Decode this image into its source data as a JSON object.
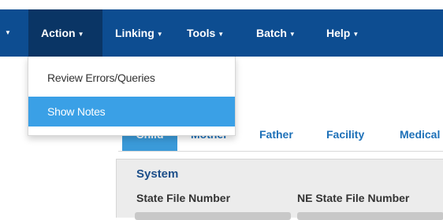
{
  "nav": {
    "items": [
      {
        "label": "Action",
        "active": true
      },
      {
        "label": "Linking"
      },
      {
        "label": "Tools"
      },
      {
        "label": "Batch"
      },
      {
        "label": "Help"
      }
    ]
  },
  "action_menu": {
    "items": [
      {
        "label": "Review Errors/Queries"
      },
      {
        "label": "Show Notes",
        "highlighted": true
      }
    ]
  },
  "tabs": [
    {
      "label": "Child",
      "active": true
    },
    {
      "label": "Mother"
    },
    {
      "label": "Father"
    },
    {
      "label": "Facility"
    },
    {
      "label": "Medical"
    }
  ],
  "panel": {
    "section_title": "System",
    "fields": [
      {
        "label": "State File Number"
      },
      {
        "label": "NE State File Number"
      }
    ]
  },
  "colors": {
    "navbar": "#0d4d91",
    "navbar_active": "#0a3565",
    "menu_highlight": "#3aa0e6",
    "tab_active": "#3a9ad9",
    "tab_text": "#1d70b8"
  }
}
